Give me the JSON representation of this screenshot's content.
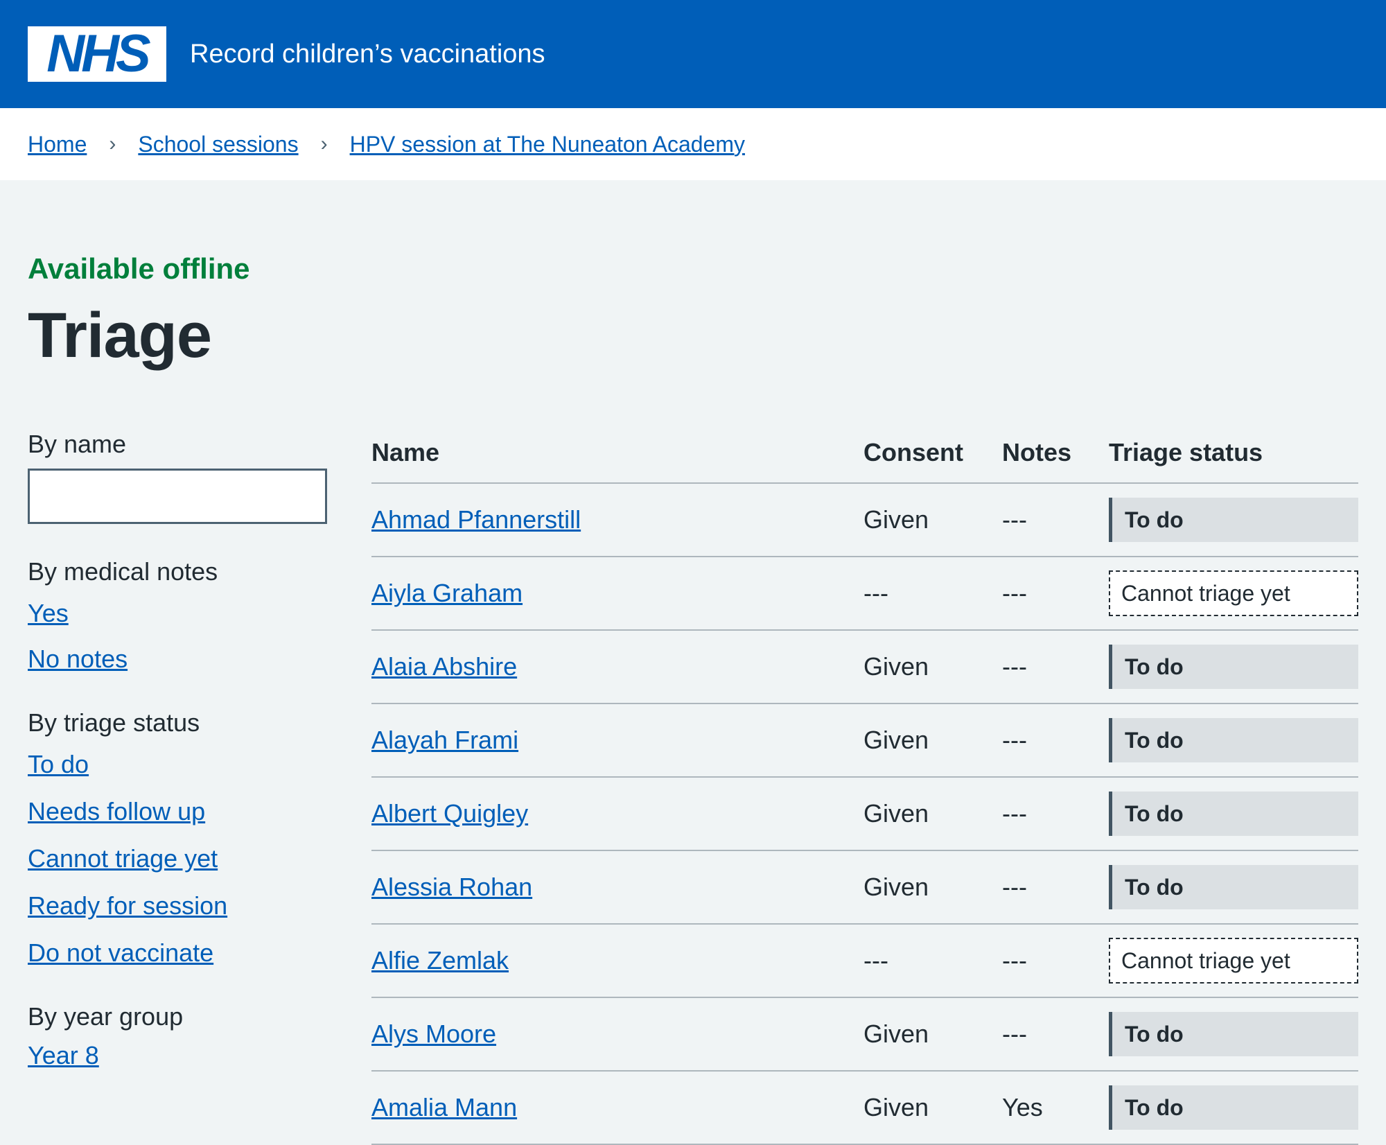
{
  "header": {
    "logo": "NHS",
    "service_name": "Record children’s vaccinations"
  },
  "breadcrumb": [
    {
      "label": "Home"
    },
    {
      "label": "School sessions"
    },
    {
      "label": "HPV session at The Nuneaton Academy"
    }
  ],
  "page": {
    "caption": "Available offline",
    "title": "Triage"
  },
  "filters": {
    "by_name": {
      "label": "By name",
      "value": ""
    },
    "medical_notes": {
      "label": "By medical notes",
      "options": [
        "Yes",
        "No notes"
      ]
    },
    "triage_status": {
      "label": "By triage status",
      "options": [
        "To do",
        "Needs follow up",
        "Cannot triage yet",
        "Ready for session",
        "Do not vaccinate"
      ]
    },
    "year_group": {
      "label": "By year group",
      "options": [
        "Year 8"
      ]
    }
  },
  "table": {
    "headers": {
      "name": "Name",
      "consent": "Consent",
      "notes": "Notes",
      "status": "Triage status"
    },
    "rows": [
      {
        "name": "Ahmad Pfannerstill",
        "consent": "Given",
        "notes": "---",
        "status": "To do"
      },
      {
        "name": "Aiyla Graham",
        "consent": "---",
        "notes": "---",
        "status": "Cannot triage yet"
      },
      {
        "name": "Alaia Abshire",
        "consent": "Given",
        "notes": "---",
        "status": "To do"
      },
      {
        "name": "Alayah Frami",
        "consent": "Given",
        "notes": "---",
        "status": "To do"
      },
      {
        "name": "Albert Quigley",
        "consent": "Given",
        "notes": "---",
        "status": "To do"
      },
      {
        "name": "Alessia Rohan",
        "consent": "Given",
        "notes": "---",
        "status": "To do"
      },
      {
        "name": "Alfie Zemlak",
        "consent": "---",
        "notes": "---",
        "status": "Cannot triage yet"
      },
      {
        "name": "Alys Moore",
        "consent": "Given",
        "notes": "---",
        "status": "To do"
      },
      {
        "name": "Amalia Mann",
        "consent": "Given",
        "notes": "Yes",
        "status": "To do"
      }
    ]
  },
  "colors": {
    "brand_blue": "#005eb8",
    "offline_green": "#007f3b",
    "page_bg": "#f0f4f5"
  }
}
